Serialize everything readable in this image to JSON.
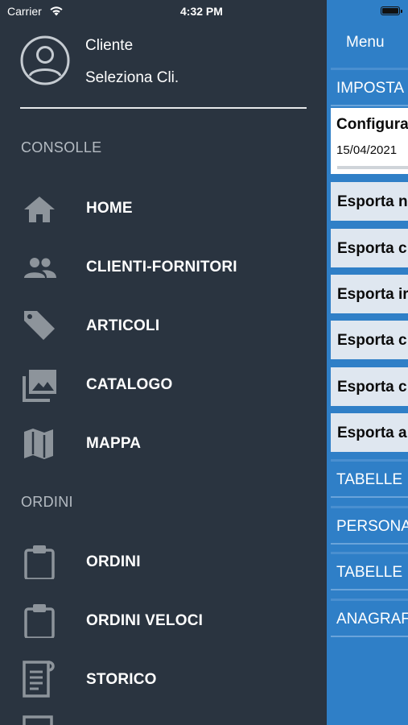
{
  "status_bar": {
    "carrier": "Carrier",
    "time": "4:32 PM"
  },
  "drawer": {
    "profile": {
      "name": "Cliente",
      "subtitle": "Seleziona Cli."
    },
    "sections": [
      {
        "title": "CONSOLLE",
        "items": [
          {
            "label": "HOME",
            "icon": "home-icon"
          },
          {
            "label": "CLIENTI-FORNITORI",
            "icon": "people-icon"
          },
          {
            "label": "ARTICOLI",
            "icon": "tag-icon"
          },
          {
            "label": "CATALOGO",
            "icon": "photo-library-icon"
          },
          {
            "label": "MAPPA",
            "icon": "map-icon"
          }
        ]
      },
      {
        "title": "ORDINI",
        "items": [
          {
            "label": "ORDINI",
            "icon": "clipboard-icon"
          },
          {
            "label": "ORDINI VELOCI",
            "icon": "clipboard-icon"
          },
          {
            "label": "STORICO",
            "icon": "document-icon"
          }
        ]
      }
    ]
  },
  "main": {
    "title": "Menu",
    "rows": [
      {
        "type": "header",
        "text": "IMPOSTA"
      },
      {
        "type": "config",
        "title": "Configura",
        "date": "15/04/2021"
      },
      {
        "type": "light",
        "text": "Esporta n"
      },
      {
        "type": "light",
        "text": "Esporta c"
      },
      {
        "type": "light",
        "text": "Esporta ir"
      },
      {
        "type": "light",
        "text": "Esporta c"
      },
      {
        "type": "light",
        "text": "Esporta c"
      },
      {
        "type": "light",
        "text": "Esporta a"
      },
      {
        "type": "header",
        "text": "TABELLE"
      },
      {
        "type": "header",
        "text": "PERSONA"
      },
      {
        "type": "header",
        "text": "TABELLE"
      },
      {
        "type": "header",
        "text": "ANAGRAF"
      }
    ]
  },
  "colors": {
    "drawer_bg": "#2a3440",
    "main_bg": "#2f7fc7",
    "row_light": "#dfe7f0"
  }
}
